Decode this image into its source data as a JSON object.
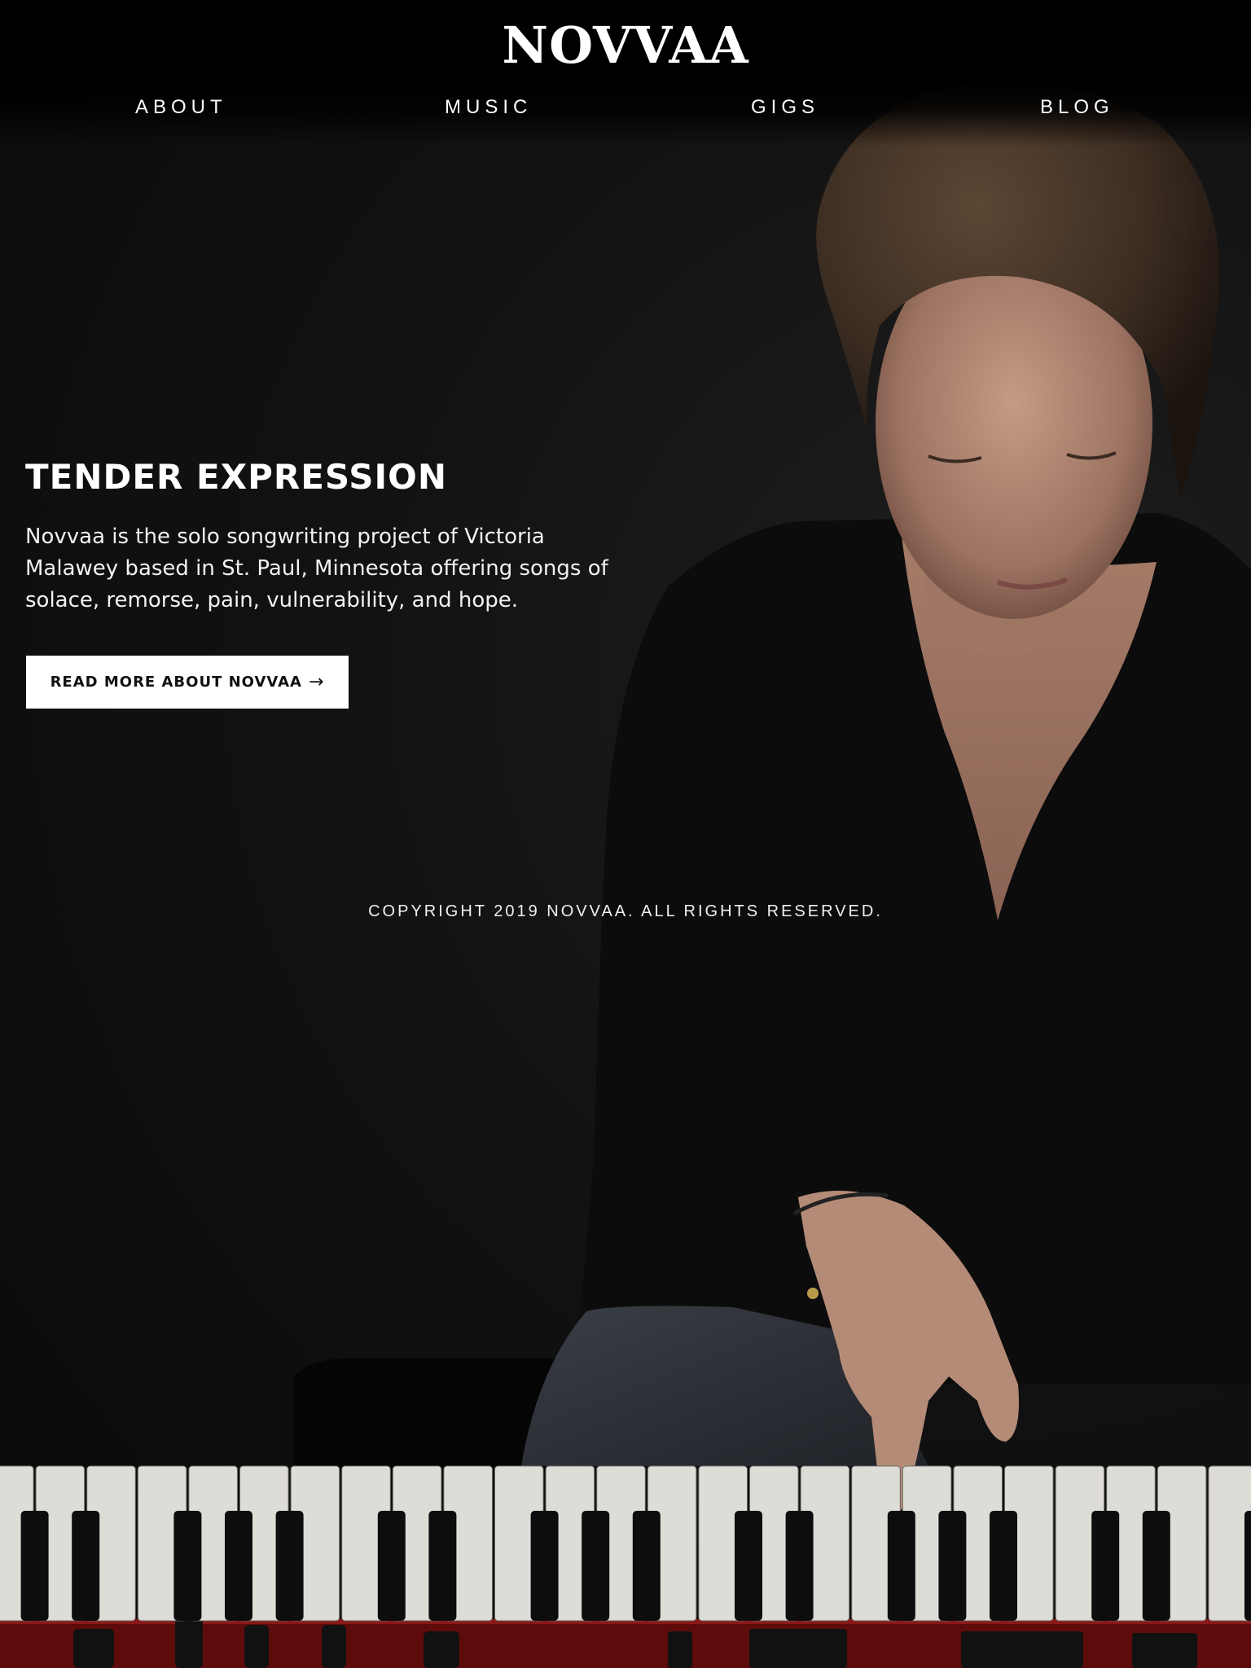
{
  "brand": {
    "logo_text": "NOVVAA"
  },
  "nav": {
    "items": [
      {
        "label": "ABOUT"
      },
      {
        "label": "MUSIC"
      },
      {
        "label": "GIGS"
      },
      {
        "label": "BLOG"
      }
    ]
  },
  "hero": {
    "title": "TENDER EXPRESSION",
    "body": "Novvaa is the solo songwriting project of Victoria Malawey based in St. Paul, Minnesota offering songs of solace, remorse, pain, vulnerability, and hope.",
    "button_label": "READ MORE ABOUT NOVVAA",
    "button_arrow": "→"
  },
  "footer": {
    "copyright": "COPYRIGHT 2019 NOVVAA. ALL RIGHTS RESERVED."
  },
  "colors": {
    "background": "#0b0b0b",
    "text": "#ffffff",
    "button_bg": "#ffffff",
    "button_text": "#111111",
    "keyboard_frame": "#7a1010"
  }
}
